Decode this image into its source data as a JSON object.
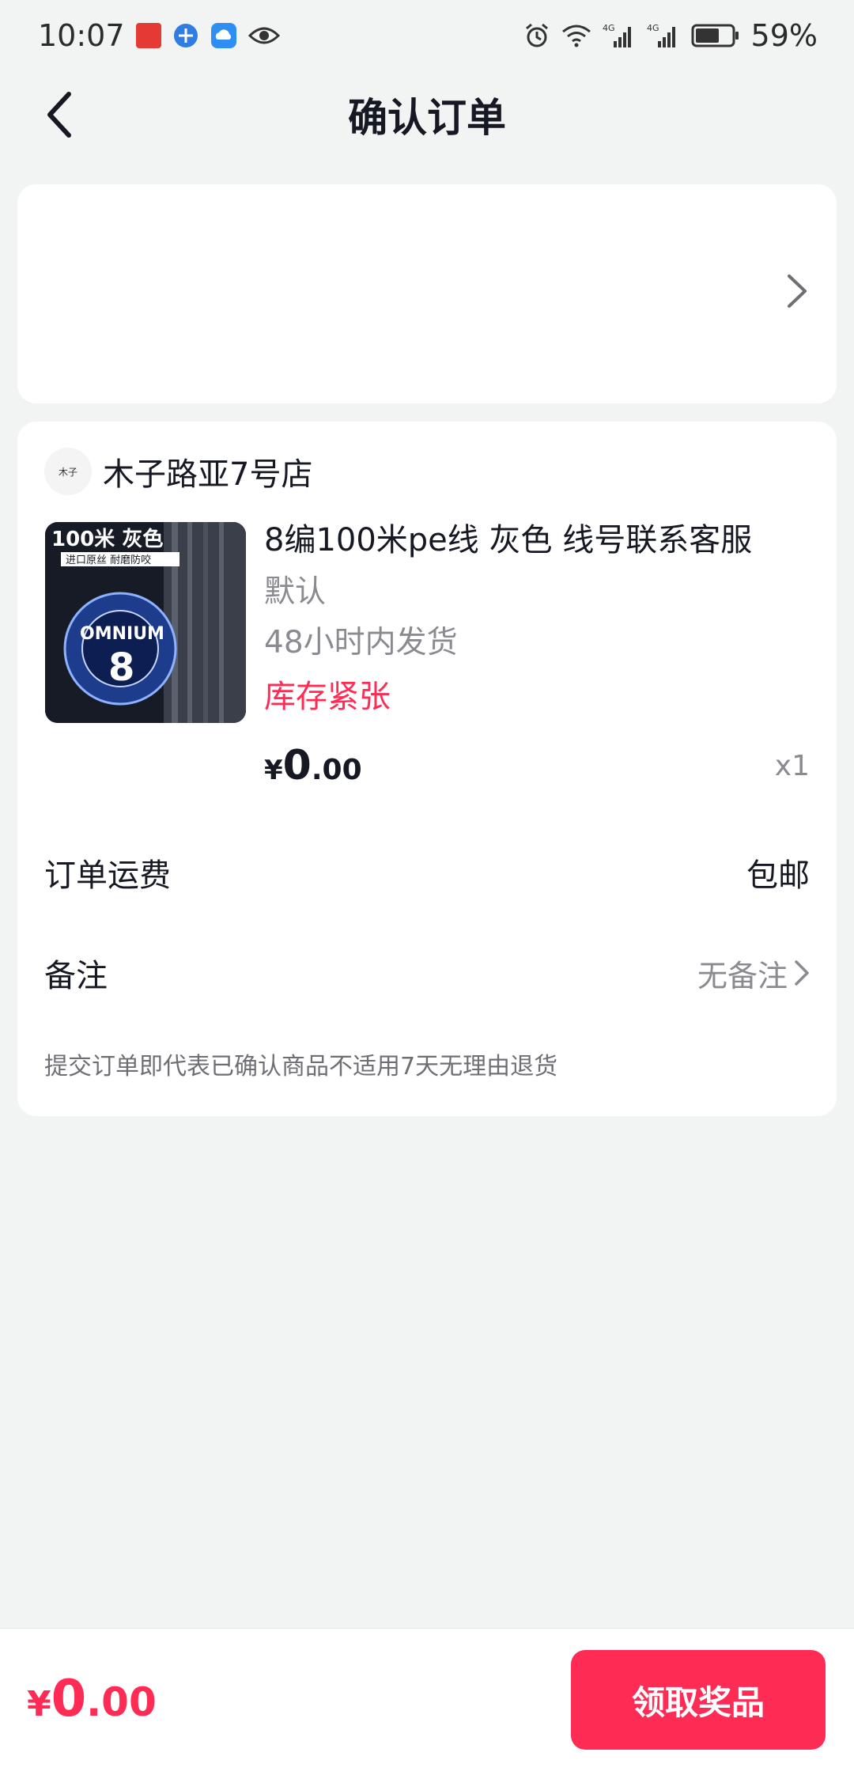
{
  "status_bar": {
    "time": "10:07",
    "battery": "59%",
    "net1": "4G",
    "net2": "4G"
  },
  "header": {
    "title": "确认订单"
  },
  "shop": {
    "name": "木子路亚7号店",
    "logo_text": "木子"
  },
  "product": {
    "title": "8编100米pe线 灰色 线号联系客服",
    "sku": "默认",
    "shipping": "48小时内发货",
    "stock": "库存紧张",
    "price_currency": "¥",
    "price_int": "0",
    "price_dec": ".00",
    "quantity": "x1",
    "image_label_top": "100米 灰色",
    "image_label_sub": "进口原丝 耐磨防咬",
    "image_brand": "OMNIUM",
    "image_number": "8"
  },
  "freight": {
    "label": "订单运费",
    "value": "包邮"
  },
  "note": {
    "label": "备注",
    "value": "无备注"
  },
  "disclaimer": "提交订单即代表已确认商品不适用7天无理由退货",
  "bottom": {
    "currency": "¥",
    "total_int": "0",
    "total_dec": ".00",
    "submit_label": "领取奖品"
  },
  "colors": {
    "accent": "#fe2c55",
    "background": "#f2f3f3",
    "muted": "#8a8b91"
  }
}
